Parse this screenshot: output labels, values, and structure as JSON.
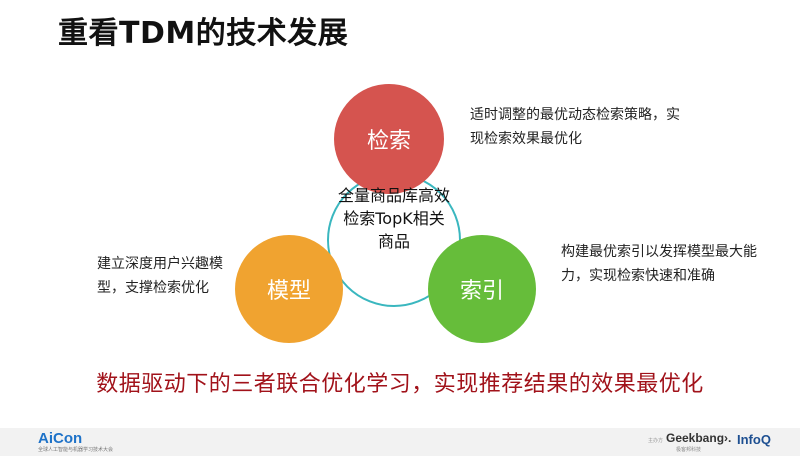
{
  "title": "重看TDM的技术发展",
  "circles": {
    "search": {
      "label": "检索",
      "color": "#d5544f"
    },
    "model": {
      "label": "模型",
      "color": "#f0a330"
    },
    "index": {
      "label": "索引",
      "color": "#66bd3a"
    }
  },
  "core": {
    "text": "全量商品库高效检索TopK相关商品",
    "border_color": "#3ab7bf"
  },
  "descriptions": {
    "search": "适时调整的最优动态检索策略，实现检索效果最优化",
    "model": "建立深度用户兴趣模型，支撑检索优化",
    "index": "构建最优索引以发挥模型最大能力，实现检索快速和准确"
  },
  "bottom_text": "数据驱动下的三者联合优化学习，实现推荐结果的效果最优化",
  "footer": {
    "logo": "AiCon",
    "logo_sub": "全球人工智能与机器学习技术大会",
    "host_label": "主办方",
    "geekbang": "Geekbang›.",
    "geekbang_sub": "极客邦科技",
    "infoq": "InfoQ"
  }
}
